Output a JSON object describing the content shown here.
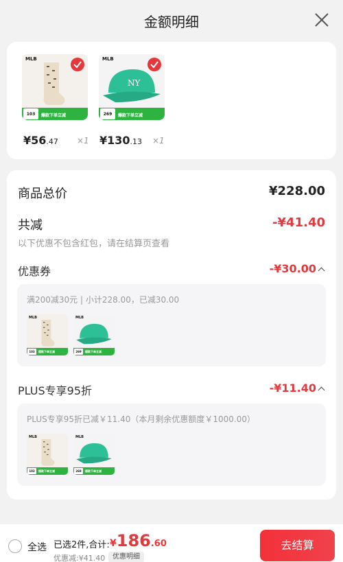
{
  "header": {
    "title": "金额明细"
  },
  "products": [
    {
      "brand": "MLB",
      "tag_price": "103",
      "promo": "爆款下单立减",
      "price_int": "¥56",
      "price_dec": ".47",
      "qty": "×1",
      "colors": {
        "bg": "#f4f1ec",
        "item": "#e9ddc8"
      }
    },
    {
      "brand": "MLB",
      "tag_price": "269",
      "promo": "爆款下单立减",
      "price_int": "¥130",
      "price_dec": ".13",
      "qty": "×1",
      "colors": {
        "bg": "#f4f4f4",
        "item": "#2dbf95"
      }
    }
  ],
  "summary": {
    "total_label": "商品总价",
    "total_value": "¥228.00",
    "discount_label": "共减",
    "discount_value": "-¥41.40",
    "discount_note": "以下优惠不包含红包，请在结算页查看",
    "coupon": {
      "label": "优惠券",
      "value": "-¥30.00",
      "note": "满200减30元 | 小计228.00，已减30.00"
    },
    "plus": {
      "label": "PLUS专享95折",
      "value": "-¥11.40",
      "note": "PLUS专享95折已减￥11.40（本月剩余优惠额度￥1000.00）"
    }
  },
  "bottom": {
    "select_all": "全选",
    "selected_count": "已选2件,合计:",
    "total_symbol": "¥",
    "total_int": "186",
    "total_dec": ".60",
    "saved": "优惠减:¥41.40",
    "detail_label": "优惠明细",
    "checkout_label": "去结算"
  },
  "colors": {
    "accent": "#e4393c",
    "promo_green": "#2fb340"
  }
}
